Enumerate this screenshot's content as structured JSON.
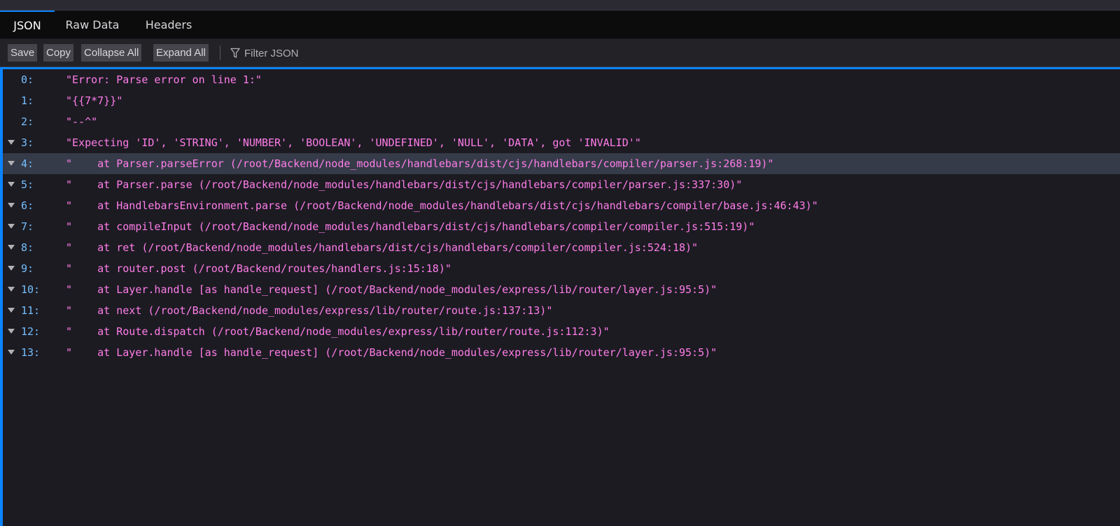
{
  "tabs": [
    {
      "label": "JSON",
      "selected": true
    },
    {
      "label": "Raw Data",
      "selected": false
    },
    {
      "label": "Headers",
      "selected": false
    }
  ],
  "toolbar": {
    "save_label": "Save",
    "copy_label": "Copy",
    "collapse_label": "Collapse All",
    "expand_label": "Expand All",
    "filter_placeholder": "Filter JSON",
    "filter_icon": "filter-icon"
  },
  "colors": {
    "accent": "#0a84ff",
    "key": "#75bfff",
    "string": "#ff7de9",
    "background": "#1c1b22"
  },
  "rows": [
    {
      "key": "0:",
      "value": "\"Error: Parse error on line 1:\"",
      "expandable": false
    },
    {
      "key": "1:",
      "value": "\"{{7*7}}\"",
      "expandable": false
    },
    {
      "key": "2:",
      "value": "\"--^\"",
      "expandable": false
    },
    {
      "key": "3:",
      "value": "\"Expecting 'ID', 'STRING', 'NUMBER', 'BOOLEAN', 'UNDEFINED', 'NULL', 'DATA', got 'INVALID'\"",
      "expandable": true
    },
    {
      "key": "4:",
      "value": "\"    at Parser.parseError (/root/Backend/node_modules/handlebars/dist/cjs/handlebars/compiler/parser.js:268:19)\"",
      "expandable": true
    },
    {
      "key": "5:",
      "value": "\"    at Parser.parse (/root/Backend/node_modules/handlebars/dist/cjs/handlebars/compiler/parser.js:337:30)\"",
      "expandable": true
    },
    {
      "key": "6:",
      "value": "\"    at HandlebarsEnvironment.parse (/root/Backend/node_modules/handlebars/dist/cjs/handlebars/compiler/base.js:46:43)\"",
      "expandable": true
    },
    {
      "key": "7:",
      "value": "\"    at compileInput (/root/Backend/node_modules/handlebars/dist/cjs/handlebars/compiler/compiler.js:515:19)\"",
      "expandable": true
    },
    {
      "key": "8:",
      "value": "\"    at ret (/root/Backend/node_modules/handlebars/dist/cjs/handlebars/compiler/compiler.js:524:18)\"",
      "expandable": true
    },
    {
      "key": "9:",
      "value": "\"    at router.post (/root/Backend/routes/handlers.js:15:18)\"",
      "expandable": true
    },
    {
      "key": "10:",
      "value": "\"    at Layer.handle [as handle_request] (/root/Backend/node_modules/express/lib/router/layer.js:95:5)\"",
      "expandable": true
    },
    {
      "key": "11:",
      "value": "\"    at next (/root/Backend/node_modules/express/lib/router/route.js:137:13)\"",
      "expandable": true
    },
    {
      "key": "12:",
      "value": "\"    at Route.dispatch (/root/Backend/node_modules/express/lib/router/route.js:112:3)\"",
      "expandable": true
    },
    {
      "key": "13:",
      "value": "\"    at Layer.handle [as handle_request] (/root/Backend/node_modules/express/lib/router/layer.js:95:5)\"",
      "expandable": true
    }
  ]
}
